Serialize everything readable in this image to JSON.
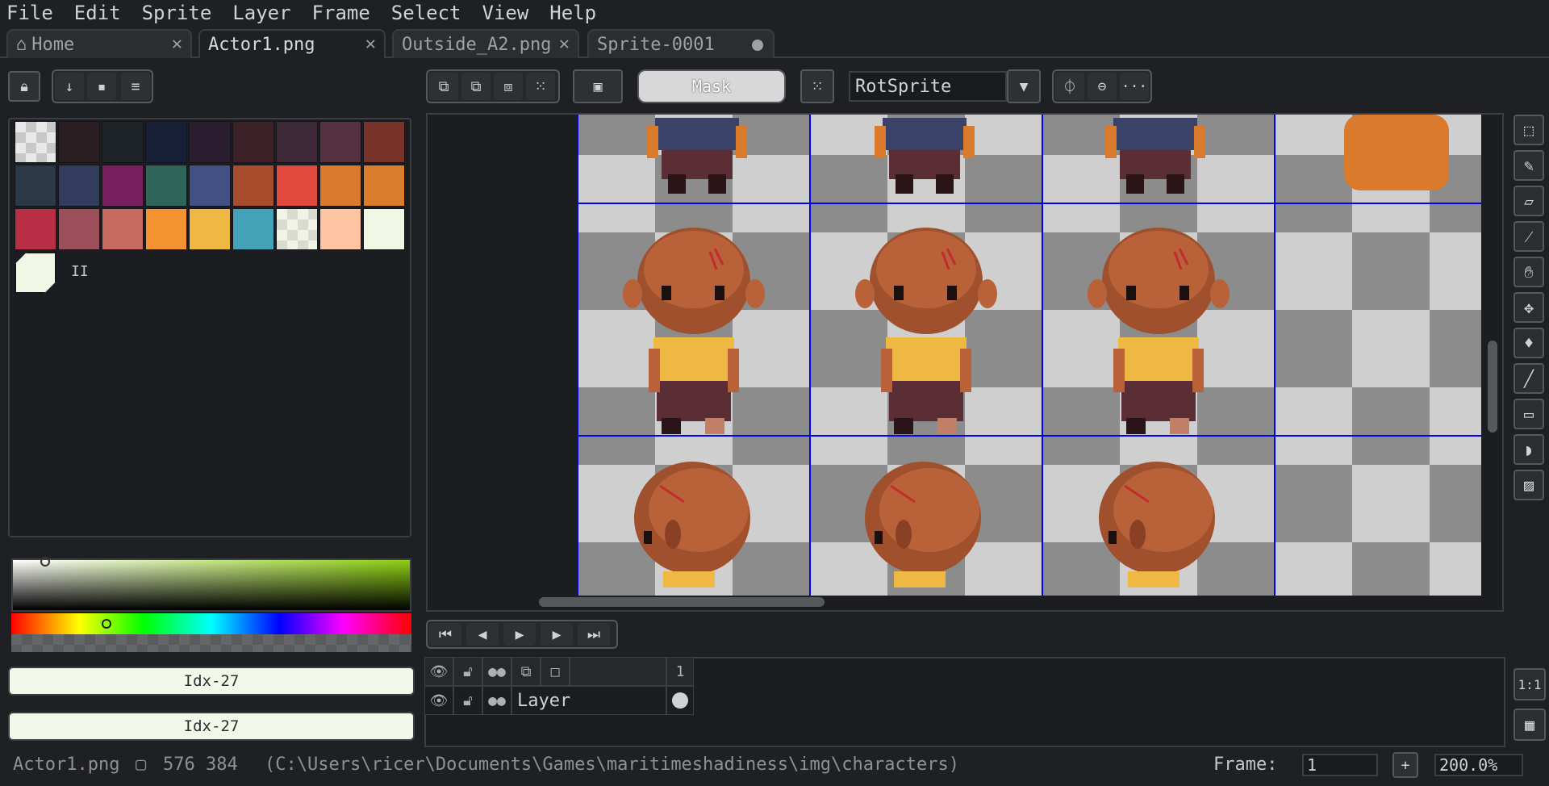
{
  "menu": [
    "File",
    "Edit",
    "Sprite",
    "Layer",
    "Frame",
    "Select",
    "View",
    "Help"
  ],
  "tabs": [
    {
      "label": "Home",
      "icon": "home-icon",
      "close": "✕"
    },
    {
      "label": "Actor1.png",
      "close": "✕"
    },
    {
      "label": "Outside_A2.png",
      "close": "✕"
    },
    {
      "label": "Sprite-0001"
    }
  ],
  "palette_toolbar": {
    "lock_icon": "lock-icon",
    "download_icon": "download-icon",
    "file_icon": "file-icon",
    "menu_icon": "menu-icon"
  },
  "palette": [
    "#checker",
    "#2a1e23",
    "#1d2326",
    "#182038",
    "#2a1e30",
    "#3e2028",
    "#3f2938",
    "#55323f",
    "#7a332a",
    "#2b3846",
    "#333c5c",
    "#7a1f5d",
    "#2f6458",
    "#435083",
    "#a84c2e",
    "#e04a3e",
    "#d97a2c",
    "#d97d2a",
    "#b72e45",
    "#9c4e5a",
    "#c66a62",
    "#f59232",
    "#efb842",
    "#45a3b9",
    "#checker-light",
    "#fec5a3",
    "#f1f7e4"
  ],
  "palette_extra_label": "II",
  "selection_mode": {
    "mask_label": "Mask"
  },
  "rotation_algorithm": "RotSprite",
  "toolbar_more": "···",
  "color_fg": "Idx-27",
  "color_bg": "Idx-27",
  "colors": {
    "accent": "#8ecf12",
    "grid": "#0000ff",
    "fg_swatch": "#f4f8ea"
  },
  "timeline": {
    "frame_number": "1",
    "layer_name": "Layer"
  },
  "status": {
    "filename": "Actor1.png",
    "size": "576 384",
    "path": "(C:\\Users\\ricer\\Documents\\Games\\maritimeshadiness\\img\\characters)",
    "frame_label": "Frame:",
    "frame_value": "1",
    "add": "+",
    "zoom": "200.0%"
  },
  "zoom_fit_label": "1:1"
}
